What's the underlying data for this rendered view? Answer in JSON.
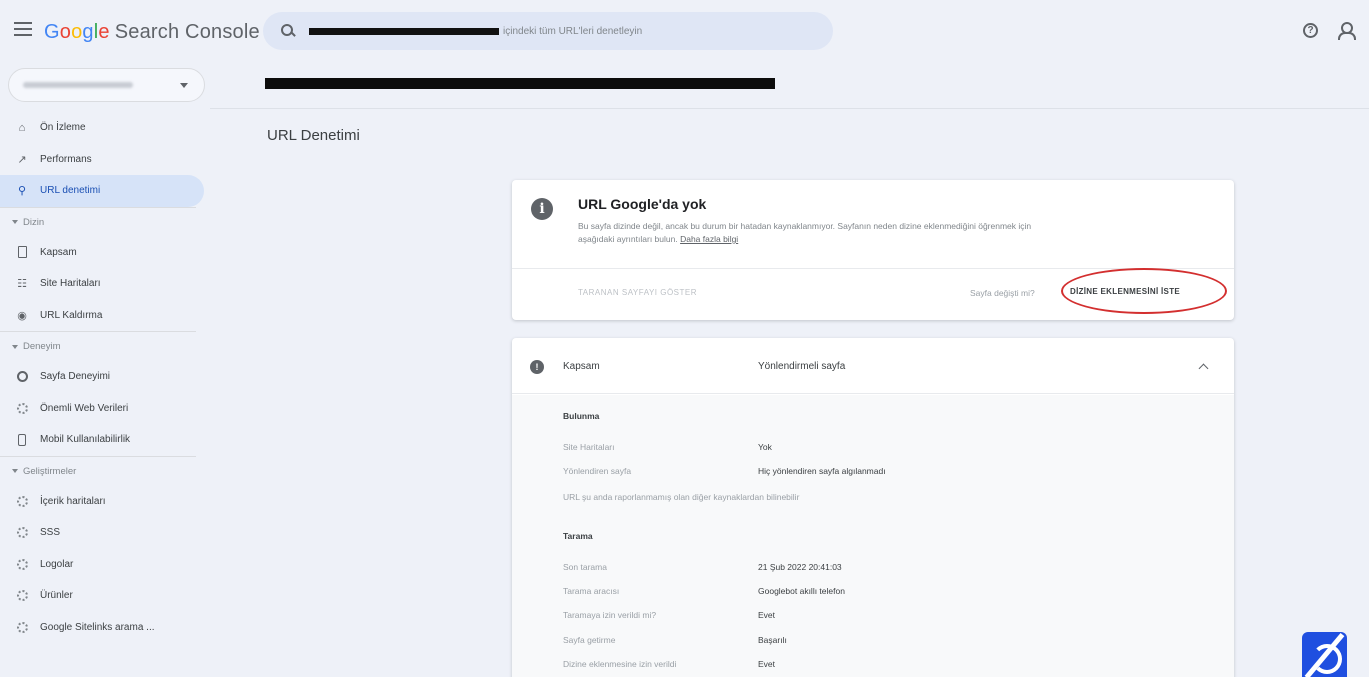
{
  "header": {
    "brand_letters": [
      "G",
      "o",
      "o",
      "g",
      "l",
      "e"
    ],
    "brand_rest": "Search Console",
    "search_placeholder": "içindeki tüm URL'leri denetleyin"
  },
  "sidebar": {
    "items_top": [
      {
        "label": "Ön İzleme",
        "icon": "home-icon"
      },
      {
        "label": "Performans",
        "icon": "trend-icon"
      },
      {
        "label": "URL denetimi",
        "icon": "search-icon",
        "active": true
      }
    ],
    "section_index": "Dizin",
    "items_index": [
      {
        "label": "Kapsam",
        "icon": "document-icon"
      },
      {
        "label": "Site Haritaları",
        "icon": "sitemap-icon"
      },
      {
        "label": "URL Kaldırma",
        "icon": "eye-off-icon"
      }
    ],
    "section_experience": "Deneyim",
    "items_experience": [
      {
        "label": "Sayfa Deneyimi",
        "icon": "circle-icon"
      },
      {
        "label": "Önemli Web Verileri",
        "icon": "gauge-icon"
      },
      {
        "label": "Mobil Kullanılabilirlik",
        "icon": "phone-icon"
      }
    ],
    "section_enhancements": "Geliştirmeler",
    "items_enhancements": [
      {
        "label": "İçerik haritaları",
        "icon": "gear-icon"
      },
      {
        "label": "SSS",
        "icon": "gear-icon"
      },
      {
        "label": "Logolar",
        "icon": "gear-icon"
      },
      {
        "label": "Ürünler",
        "icon": "gear-icon"
      },
      {
        "label": "Google Sitelinks arama ...",
        "icon": "gear-icon"
      }
    ]
  },
  "main": {
    "page_title": "URL Denetimi",
    "status_card": {
      "title": "URL Google'da yok",
      "description": "Bu sayfa dizinde değil, ancak bu durum bir hatadan kaynaklanmıyor. Sayfanın neden dizine eklenmediğini öğrenmek için aşağıdaki ayrıntıları bulun.",
      "learn_more": "Daha fazla bilgi",
      "view_crawled": "TARANAN SAYFAYI GÖSTER",
      "changed_question": "Sayfa değişti mi?",
      "request_indexing": "DİZİNE EKLENMESİNİ İSTE"
    },
    "coverage_card": {
      "label": "Kapsam",
      "value": "Yönlendirmeli sayfa",
      "discovery_title": "Bulunma",
      "discovery_rows": [
        {
          "label": "Site Haritaları",
          "value": "Yok"
        },
        {
          "label": "Yönlendiren sayfa",
          "value": "Hiç yönlendiren sayfa algılanmadı"
        }
      ],
      "discovery_note": "URL şu anda raporlanmamış olan diğer kaynaklardan bilinebilir",
      "crawl_title": "Tarama",
      "crawl_rows": [
        {
          "label": "Son tarama",
          "value": "21 Şub 2022 20:41:03"
        },
        {
          "label": "Tarama aracısı",
          "value": "Googlebot akıllı telefon"
        },
        {
          "label": "Taramaya izin verildi mi?",
          "value": "Evet"
        },
        {
          "label": "Sayfa getirme",
          "value": "Başarılı"
        },
        {
          "label": "Dizine eklenmesine izin verildi",
          "value": "Evet"
        }
      ]
    }
  },
  "colors": {
    "accent": "#1a73e8",
    "highlight_circle": "#d32f2f",
    "active_nav_bg": "#d6e3f8"
  }
}
